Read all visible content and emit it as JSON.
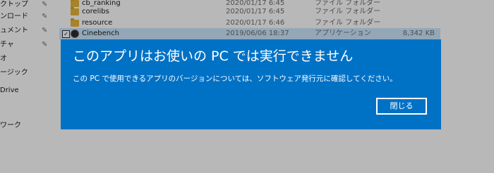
{
  "sidebar": {
    "items": [
      {
        "label": "クトップ",
        "pinned": true
      },
      {
        "label": "ンロード",
        "pinned": true
      },
      {
        "label": "ュメント",
        "pinned": true
      },
      {
        "label": "チャ",
        "pinned": true
      },
      {
        "label": "オ",
        "pinned": false
      },
      {
        "label": "ージック",
        "pinned": false
      },
      {
        "label": "Drive",
        "pinned": false
      },
      {
        "label": "ワーク",
        "pinned": false
      }
    ]
  },
  "files": {
    "rows": [
      {
        "name": "cb_ranking",
        "date": "2020/01/17 6:45",
        "type": "ファイル フォルダー",
        "size": "",
        "icon": "folder-icon"
      },
      {
        "name": "corelibs",
        "date": "2020/01/17 6:45",
        "type": "ファイル フォルダー",
        "size": "",
        "icon": "folder-icon"
      },
      {
        "name": "resource",
        "date": "2020/01/17 6:46",
        "type": "ファイル フォルダー",
        "size": "",
        "icon": "folder-icon"
      },
      {
        "name": "Cinebench",
        "date": "2019/06/06 18:37",
        "type": "アプリケーション",
        "size": "8,342 KB",
        "icon": "cinebench-app-icon",
        "selected": true,
        "checked": true
      }
    ]
  },
  "dialog": {
    "title": "このアプリはお使いの PC では実行できません",
    "message": "この PC で使用できるアプリのバージョンについては、ソフトウェア発行元に確認してください。",
    "close_label": "閉じる",
    "background_color": "#0072c6",
    "text_color": "#ffffff"
  }
}
